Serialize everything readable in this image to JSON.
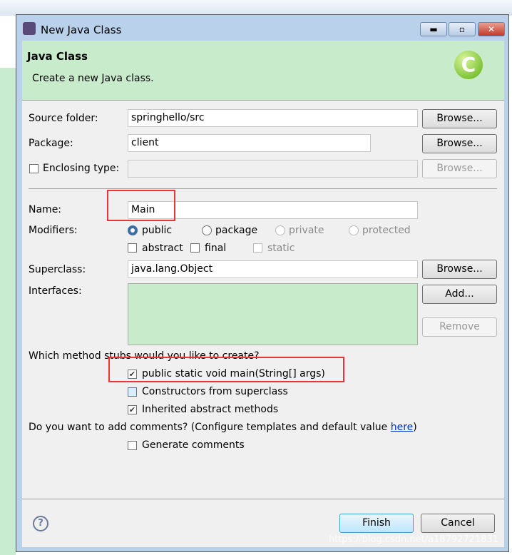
{
  "window": {
    "title": "New Java Class"
  },
  "header": {
    "title": "Java Class",
    "subtitle": "Create a new Java class."
  },
  "form": {
    "source_folder": {
      "label": "Source folder:",
      "value": "springhello/src",
      "button": "Browse..."
    },
    "package": {
      "label": "Package:",
      "value": "client",
      "button": "Browse..."
    },
    "enclosing": {
      "label": "Enclosing type:",
      "value": "",
      "button": "Browse...",
      "checked": false
    },
    "name": {
      "label": "Name:",
      "value": "Main"
    },
    "modifiers": {
      "label": "Modifiers:",
      "access": [
        "public",
        "package",
        "private",
        "protected"
      ],
      "selected": "public",
      "abstract": "abstract",
      "final": "final",
      "static": "static"
    },
    "superclass": {
      "label": "Superclass:",
      "value": "java.lang.Object",
      "button": "Browse..."
    },
    "interfaces": {
      "label": "Interfaces:",
      "add": "Add...",
      "remove": "Remove"
    },
    "stubs": {
      "question": "Which method stubs would you like to create?",
      "items": [
        {
          "label": "public static void main(String[] args)",
          "checked": true
        },
        {
          "label": "Constructors from superclass",
          "checked": false
        },
        {
          "label": "Inherited abstract methods",
          "checked": true
        }
      ]
    },
    "comments": {
      "question_pre": "Do you want to add comments? (Configure templates and default value ",
      "link": "here",
      "question_post": ")",
      "generate": "Generate comments",
      "checked": false
    }
  },
  "footer": {
    "finish": "Finish",
    "cancel": "Cancel"
  },
  "watermark": "https://blog.csdn.net/a18792721831",
  "colors": {
    "header": "#c7ebcb",
    "highlight": "#e33333",
    "link": "#0033cc"
  }
}
